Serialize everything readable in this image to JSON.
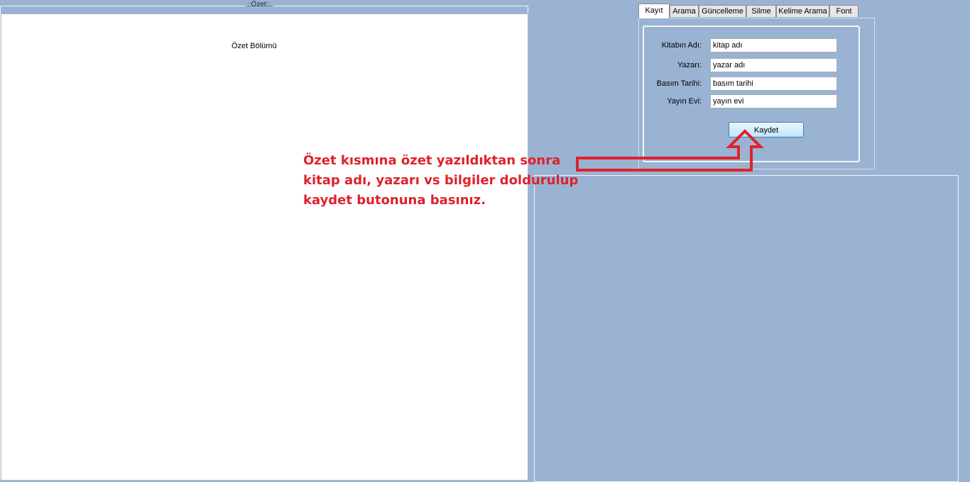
{
  "ozet": {
    "legend": "::Özet::.",
    "placeholder": "Özet Bölümü"
  },
  "tabs": [
    {
      "label": "Kayıt",
      "active": true
    },
    {
      "label": "Arama",
      "active": false
    },
    {
      "label": "Güncelleme",
      "active": false
    },
    {
      "label": "Silme",
      "active": false
    },
    {
      "label": "Kelime Arama",
      "active": false
    },
    {
      "label": "Font",
      "active": false
    }
  ],
  "form": {
    "fields": [
      {
        "label": "Kitabın Adı:",
        "value": "kitap adı"
      },
      {
        "label": "Yazarı:",
        "value": "yazar adı"
      },
      {
        "label": "Basım Tarihi:",
        "value": "basım tarihi"
      },
      {
        "label": "Yayın Evi:",
        "value": "yayın evi"
      }
    ],
    "save_label": "Kaydet"
  },
  "annotation": {
    "lines": [
      "Özet kısmına özet yazıldıktan sonra",
      "kitap adı, yazarı vs bilgiler doldurulup",
      "kaydet butonuna basınız."
    ],
    "color": "#e0212b"
  },
  "colors": {
    "background": "#9ab3d2",
    "accent": "#e0212b"
  }
}
